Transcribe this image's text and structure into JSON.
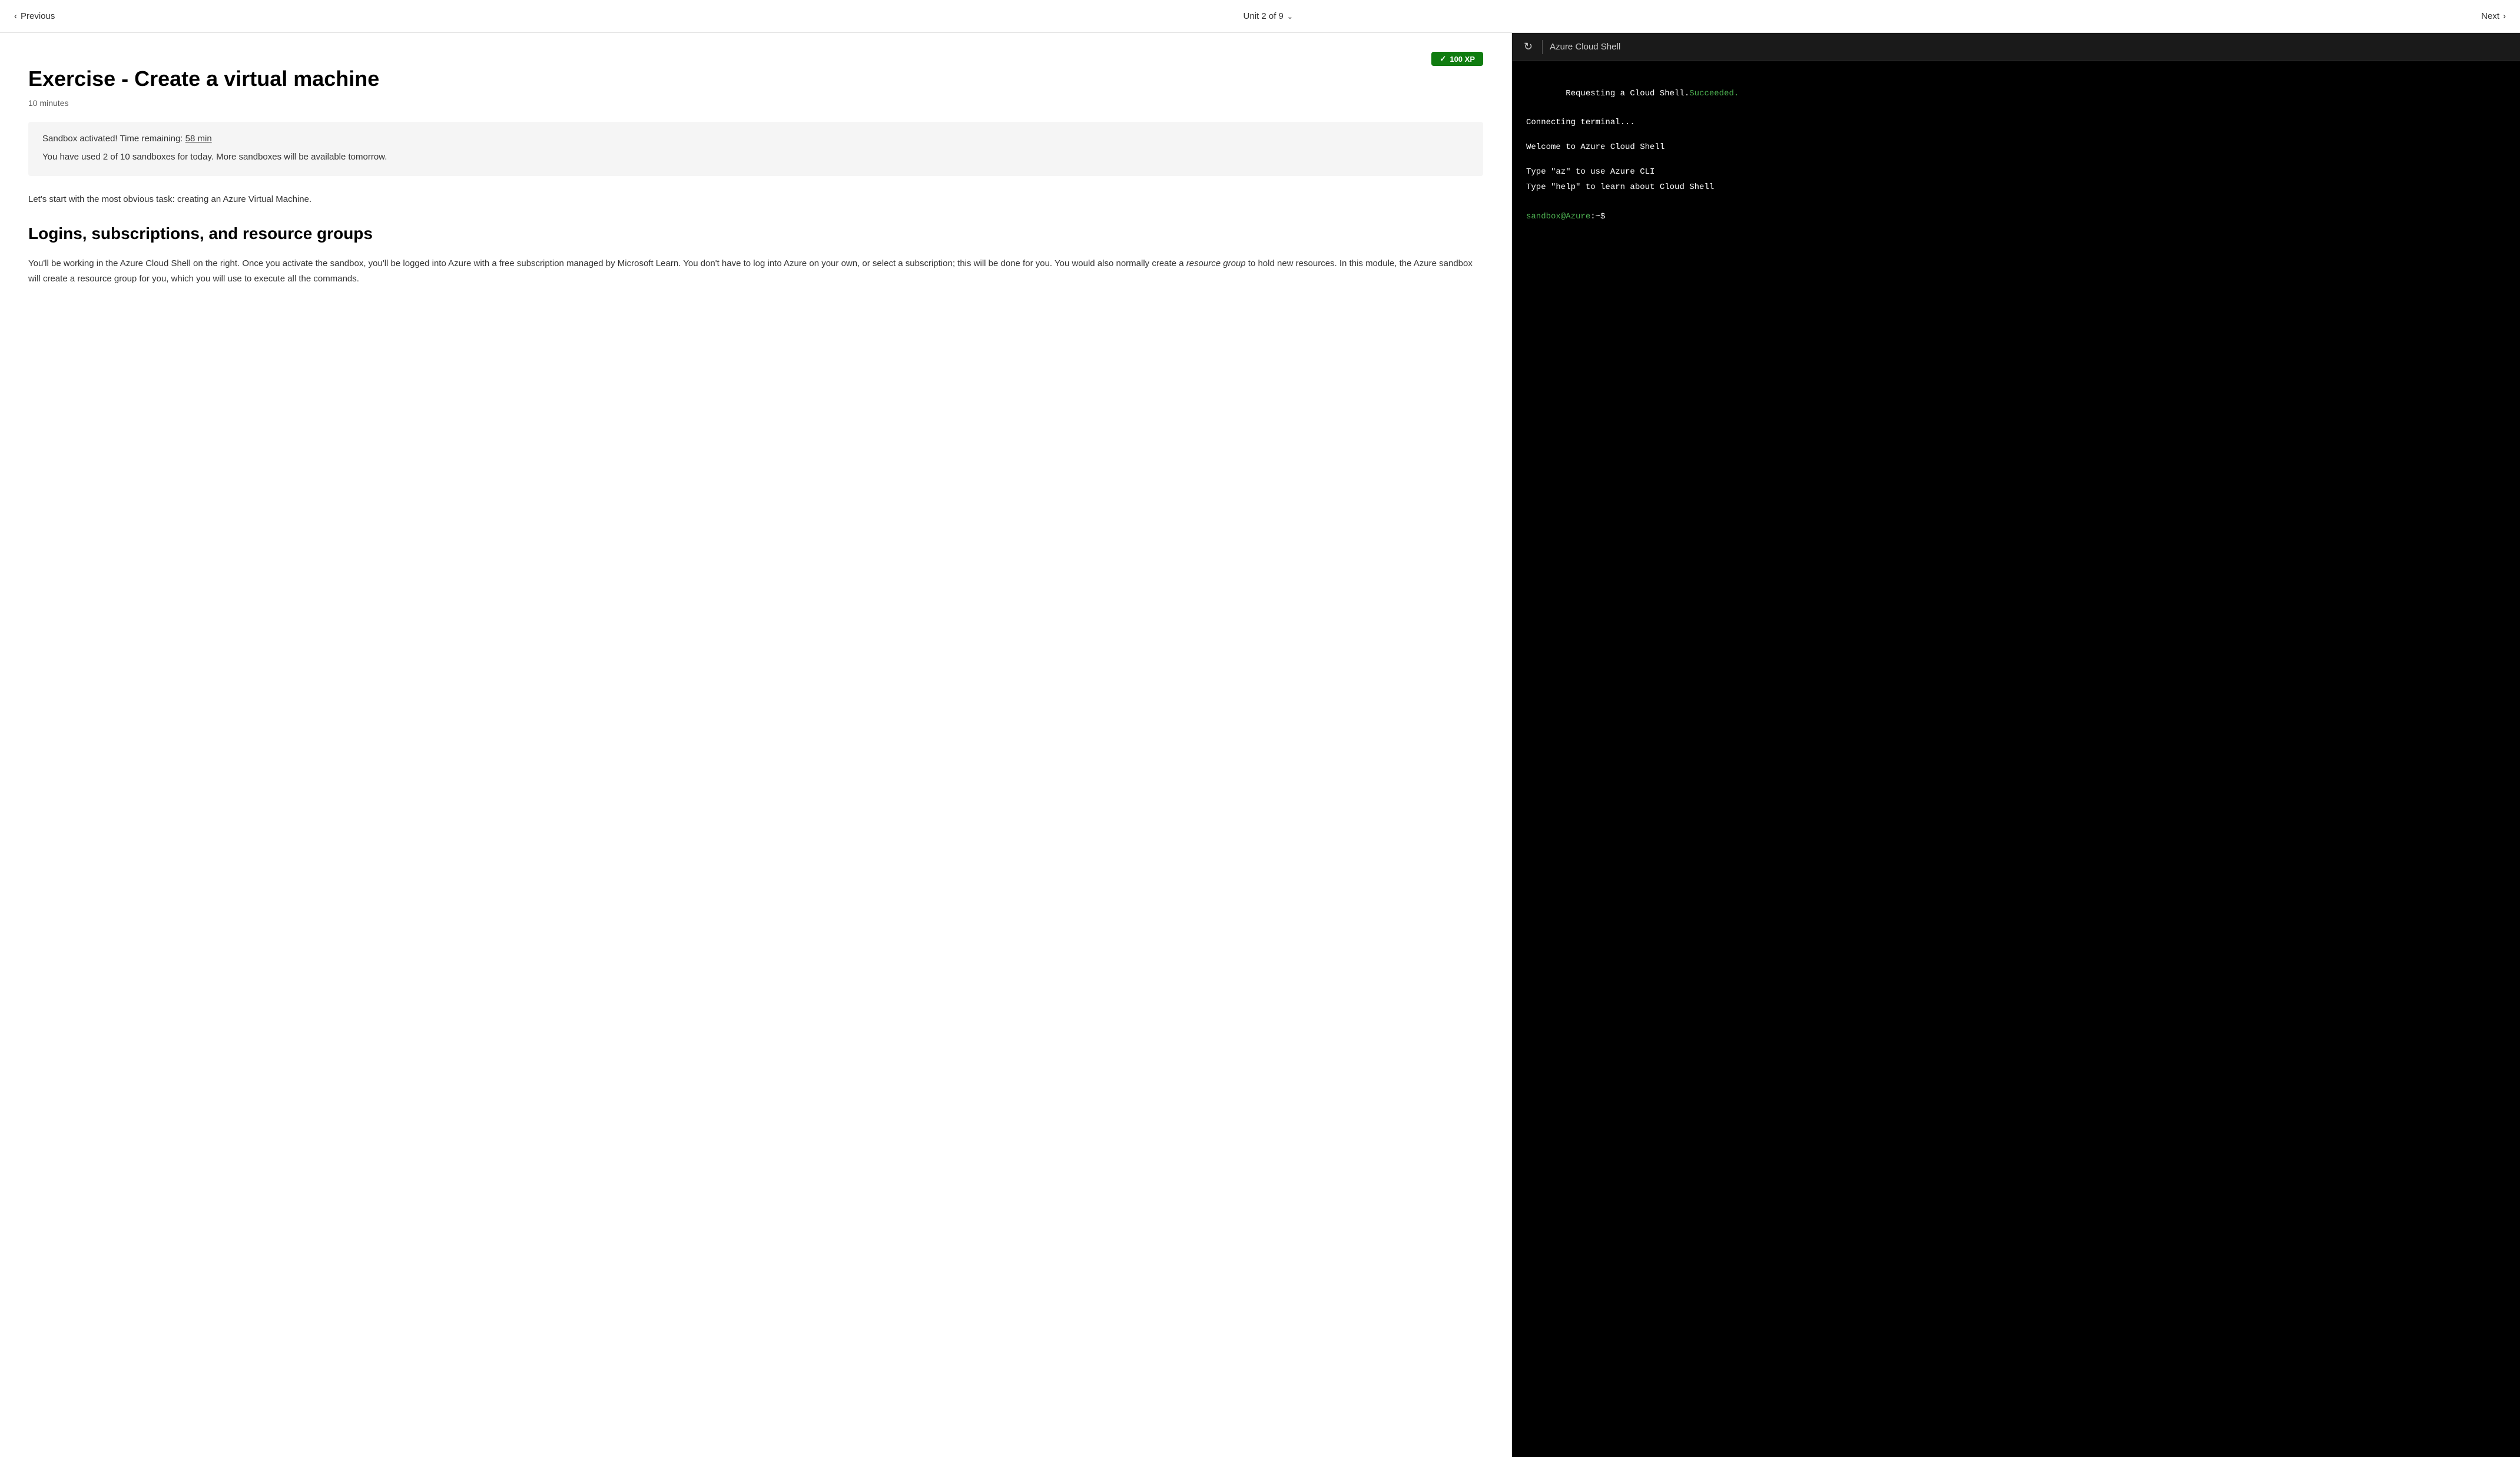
{
  "nav": {
    "previous_label": "Previous",
    "next_label": "Next",
    "unit_label": "Unit 2 of 9"
  },
  "content": {
    "xp_badge": "100 XP",
    "title": "Exercise - Create a virtual machine",
    "time_estimate": "10 minutes",
    "sandbox_time_label": "Sandbox activated! Time remaining:",
    "sandbox_time_value": "58 min",
    "sandbox_info": "You have used 2 of 10 sandboxes for today. More sandboxes will be available tomorrow.",
    "intro_text": "Let's start with the most obvious task: creating an Azure Virtual Machine.",
    "section_title": "Logins, subscriptions, and resource groups",
    "body_paragraph_1": "You'll be working in the Azure Cloud Shell on the right. Once you activate the sandbox, you'll be logged into Azure with a free subscription managed by Microsoft Learn. You don't have to log into Azure on your own, or select a subscription; this will be done for you. You would also normally create a ",
    "body_paragraph_italic": "resource group",
    "body_paragraph_2": " to hold new resources. In this module, the Azure sandbox will create a resource group for you, which you will use to execute all the commands."
  },
  "shell": {
    "title": "Azure Cloud Shell",
    "line1_normal": "Requesting a Cloud Shell.",
    "line1_green": "Succeeded.",
    "line2": "Connecting terminal...",
    "line3": "",
    "line4": "Welcome to Azure Cloud Shell",
    "line5": "",
    "line6": "Type \"az\" to use Azure CLI",
    "line7": "Type \"help\" to learn about Cloud Shell",
    "line8": "",
    "prompt_sandbox": "sandbox",
    "prompt_azure": "@Azure",
    "prompt_path": ":~$"
  }
}
